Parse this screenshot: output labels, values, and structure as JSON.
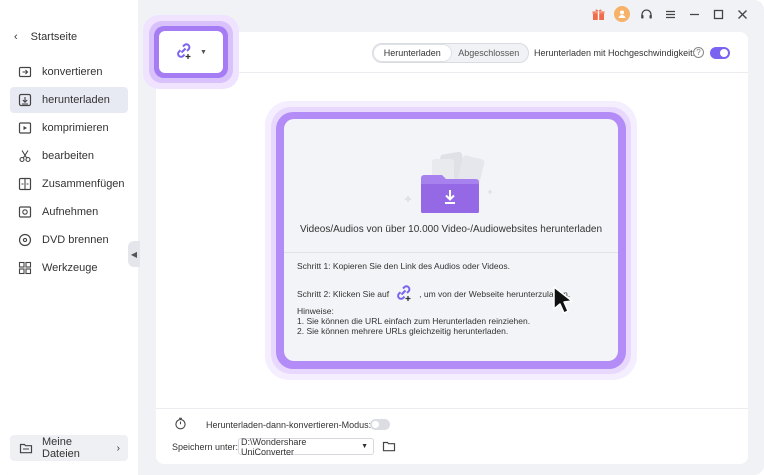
{
  "sidebar": {
    "home_label": "Startseite",
    "items": [
      {
        "label": "konvertieren",
        "icon": "convert-icon",
        "active": false
      },
      {
        "label": "herunterladen",
        "icon": "download-icon",
        "active": true
      },
      {
        "label": "komprimieren",
        "icon": "compress-icon",
        "active": false
      },
      {
        "label": "bearbeiten",
        "icon": "scissors-icon",
        "active": false
      },
      {
        "label": "Zusammenfügen",
        "icon": "merge-icon",
        "active": false
      },
      {
        "label": "Aufnehmen",
        "icon": "record-icon",
        "active": false
      },
      {
        "label": "DVD brennen",
        "icon": "dvd-icon",
        "active": false
      },
      {
        "label": "Werkzeuge",
        "icon": "toolbox-icon",
        "active": false
      }
    ],
    "my_files_label": "Meine Dateien"
  },
  "header": {
    "tabs": [
      {
        "label": "Herunterladen",
        "active": true
      },
      {
        "label": "Abgeschlossen",
        "active": false
      }
    ],
    "high_speed_label": "Herunterladen mit Hochgeschwindigkeit:",
    "high_speed_enabled": true
  },
  "dropzone": {
    "title": "Videos/Audios von über 10.000 Video-/Audiowebsites herunterladen",
    "step1": "Schritt 1: Kopieren Sie den Link des Audios oder Videos.",
    "step2_prefix": "Schritt 2: Klicken Sie auf",
    "step2_suffix": ", um von der Webseite herunterzuladen.",
    "hints_title": "Hinweise:",
    "hint1": "1. Sie können die URL einfach zum Herunterladen reinziehen.",
    "hint2": "2. Sie können mehrere URLs gleichzeitig herunterladen."
  },
  "bottom": {
    "convert_mode_label": "Herunterladen-dann-konvertieren-Modus:",
    "convert_mode_enabled": false,
    "save_label": "Speichern unter:",
    "save_path": "D:\\Wondershare UniConverter"
  },
  "colors": {
    "accent": "#7b63f2",
    "glow": "#b48cf7",
    "gift": "#ef6b4b"
  }
}
